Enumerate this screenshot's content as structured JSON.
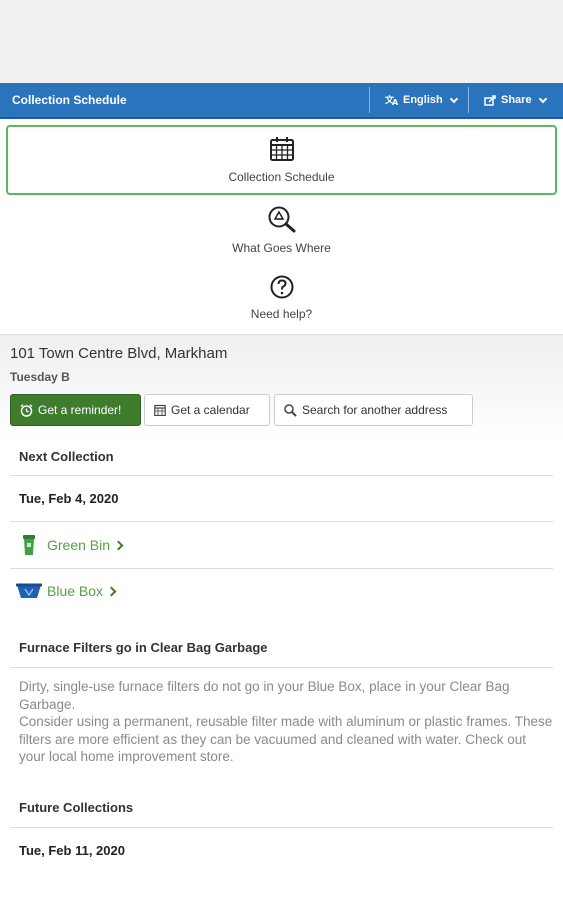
{
  "topbar": {
    "title": "Collection Schedule",
    "language_label": "English",
    "share_label": "Share"
  },
  "nav": {
    "items": [
      {
        "label": "Collection Schedule",
        "icon": "calendar-icon"
      },
      {
        "label": "What Goes Where",
        "icon": "recycle-search-icon"
      },
      {
        "label": "Need help?",
        "icon": "question-icon"
      }
    ]
  },
  "address": {
    "street": "101 Town Centre Blvd, Markham",
    "zone": "Tuesday B",
    "buttons": {
      "reminder": "Get a reminder!",
      "calendar": "Get a calendar",
      "search": "Search for another address"
    }
  },
  "next": {
    "heading": "Next Collection",
    "date": "Tue, Feb 4, 2020",
    "items": [
      {
        "label": "Green Bin",
        "icon": "green-bin-icon"
      },
      {
        "label": "Blue Box",
        "icon": "blue-box-icon"
      }
    ]
  },
  "notice": {
    "heading": "Furnace Filters go in Clear Bag Garbage",
    "paragraph1": "Dirty, single-use furnace filters do not go in your Blue Box, place in your Clear Bag Garbage.",
    "paragraph2": "Consider using a permanent, reusable filter made with aluminum or plastic frames. These filters are more efficient as they can be vacuumed and cleaned with water. Check out your local home improvement store."
  },
  "future": {
    "heading": "Future Collections",
    "date": "Tue, Feb 11, 2020"
  },
  "colors": {
    "header_blue": "#2a74be",
    "accent_green": "#3f7c2e",
    "bin_green": "#5a9e4a",
    "box_blue": "#1f5fb5"
  }
}
